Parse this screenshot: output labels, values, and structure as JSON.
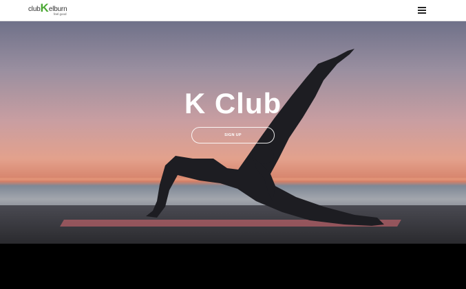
{
  "header": {
    "logo": {
      "part1": "club",
      "part2": "K",
      "part3": "elburn",
      "tagline": "feel good"
    },
    "menu_icon": "hamburger-menu-icon"
  },
  "hero": {
    "title": "K Club",
    "signup_label": "SIGN UP",
    "image": "woman-yoga-pose-sunset-pier"
  },
  "colors": {
    "header_bg": "#ffffff",
    "logo_accent": "#4aa832",
    "hero_text": "#ffffff",
    "page_bg": "#000000"
  }
}
